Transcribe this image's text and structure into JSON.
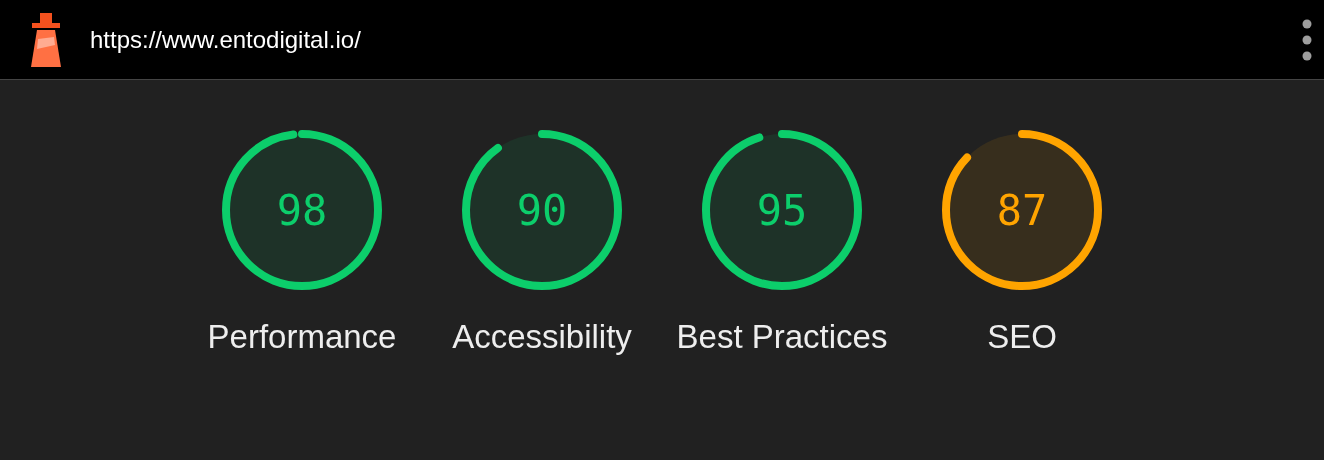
{
  "topbar": {
    "url": "https://www.entodigital.io/"
  },
  "gauges": [
    {
      "score": "98",
      "label": "Performance",
      "color": "#0cce6b"
    },
    {
      "score": "90",
      "label": "Accessibility",
      "color": "#0cce6b"
    },
    {
      "score": "95",
      "label": "Best Practices",
      "color": "#0cce6b"
    },
    {
      "score": "87",
      "label": "SEO",
      "color": "#ffa400"
    }
  ]
}
